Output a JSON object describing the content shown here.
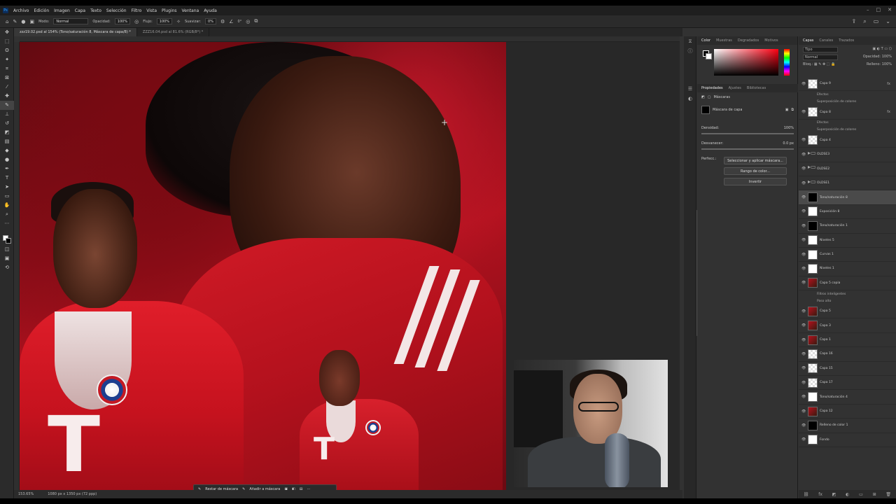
{
  "menu": {
    "app_icon": "Ps",
    "items": [
      "Archivo",
      "Edición",
      "Imagen",
      "Capa",
      "Texto",
      "Selección",
      "Filtro",
      "Vista",
      "Plugins",
      "Ventana",
      "Ayuda"
    ]
  },
  "options": {
    "mode_label": "Modo:",
    "mode_value": "Normal",
    "opacity_label": "Opacidad:",
    "opacity_value": "100%",
    "flow_label": "Flujo:",
    "flow_value": "100%",
    "smooth_label": "Suavizar:",
    "smooth_value": "0%",
    "angle_value": "0°"
  },
  "doc_tabs": [
    "zzz19.02.psd al 154% (Tono/saturación 8, Máscara de capa/8) *",
    "ZZZ16.04.psd al 81.6% (RGB/8*) *"
  ],
  "status": {
    "zoom": "153.65%",
    "dimensions": "1080 px x 1350 px (72 ppp)"
  },
  "mask_bar": {
    "subtract": "Restar de máscara",
    "add": "Añadir a máscara"
  },
  "color_panel": {
    "tabs": [
      "Color",
      "Muestras",
      "Degradados",
      "Motivos"
    ]
  },
  "properties": {
    "tabs": [
      "Propiedades",
      "Ajustes",
      "Bibliotecas"
    ],
    "section": "Máscaras",
    "mask_label": "Máscara de capa",
    "density_label": "Densidad:",
    "density_value": "100%",
    "feather_label": "Desvanecer:",
    "feather_value": "0.0 px",
    "refine_label": "Perfecc.:",
    "btn_select": "Seleccionar y aplicar máscara...",
    "btn_color_range": "Rango de color...",
    "btn_invert": "Invertir"
  },
  "layers_panel": {
    "tabs": [
      "Capas",
      "Canales",
      "Trazados"
    ],
    "kind_filter": "Tipo",
    "blend": "Normal",
    "opacity_label": "Opacidad:",
    "opacity_value": "100%",
    "lock_label": "Bloq.:",
    "fill_label": "Relleno:",
    "fill_value": "100%",
    "rows": [
      {
        "name": "Capa 9",
        "thumb": "chk",
        "fx": "fx"
      },
      {
        "name": "Efectos",
        "sub": true
      },
      {
        "name": "Superposición de colores",
        "sub": true
      },
      {
        "name": "Capa 8",
        "thumb": "chk",
        "fx": "fx"
      },
      {
        "name": "Efectos",
        "sub": true
      },
      {
        "name": "Superposición de colores",
        "sub": true
      },
      {
        "name": "Capa 4",
        "thumb": "chk"
      },
      {
        "name": "OLDSE3",
        "thumb": "fold"
      },
      {
        "name": "OLDSE2",
        "thumb": "fold"
      },
      {
        "name": "OLDSE1",
        "thumb": "fold"
      },
      {
        "name": "Tono/saturación 8",
        "thumb": "blk",
        "sel": true
      },
      {
        "name": "Exposición 8",
        "thumb": "wht"
      },
      {
        "name": "Tono/saturación 1",
        "thumb": "blk"
      },
      {
        "name": "Niveles 5",
        "thumb": "wht"
      },
      {
        "name": "Curvas 1",
        "thumb": "wht"
      },
      {
        "name": "Niveles 1",
        "thumb": "wht"
      },
      {
        "name": "Capa 5 copia",
        "thumb": "img"
      },
      {
        "name": "Filtros inteligentes",
        "sub": true
      },
      {
        "name": "Paso alto",
        "sub": true
      },
      {
        "name": "Capa 5",
        "thumb": "img"
      },
      {
        "name": "Capa 3",
        "thumb": "img"
      },
      {
        "name": "Capa 1",
        "thumb": "img"
      },
      {
        "name": "Capa 16",
        "thumb": "chk"
      },
      {
        "name": "Capa 15",
        "thumb": "chk"
      },
      {
        "name": "Capa 17",
        "thumb": "chk"
      },
      {
        "name": "Tono/saturación 4",
        "thumb": "wht"
      },
      {
        "name": "Capa 12",
        "thumb": "img"
      },
      {
        "name": "Relleno de color 1",
        "thumb": "blk"
      },
      {
        "name": "Fondo",
        "thumb": "wht"
      }
    ]
  },
  "artwork": {
    "jersey_text": "T",
    "badge_text": "FC BAYERN MÜNCHEN"
  }
}
